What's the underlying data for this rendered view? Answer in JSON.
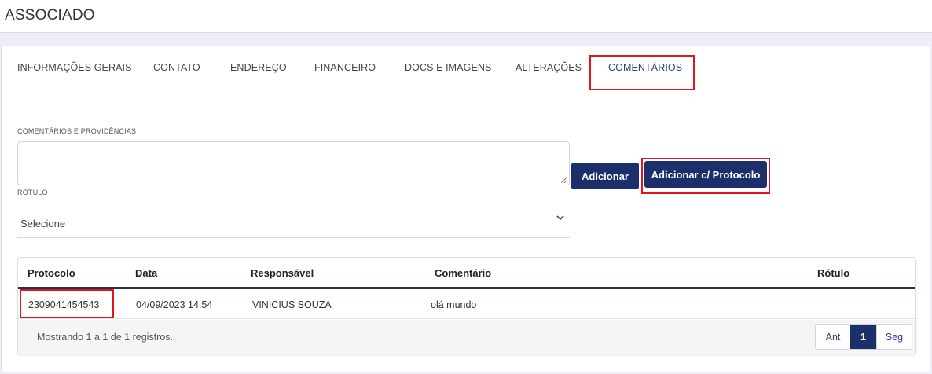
{
  "header": {
    "title": "ASSOCIADO"
  },
  "tabs": [
    {
      "label": "INFORMAÇÕES GERAIS"
    },
    {
      "label": "CONTATO"
    },
    {
      "label": "ENDEREÇO"
    },
    {
      "label": "FINANCEIRO"
    },
    {
      "label": "DOCS E IMAGENS"
    },
    {
      "label": "ALTERAÇÕES"
    },
    {
      "label": "COMENTÁRIOS"
    }
  ],
  "form": {
    "comments_label": "COMENTÁRIOS E PROVIDÊNCIAS",
    "comments_value": "",
    "add_button": "Adicionar",
    "add_protocol_button": "Adicionar c/ Protocolo",
    "label_label": "RÓTULO",
    "label_select_value": "Selecione"
  },
  "table": {
    "columns": [
      "Protocolo",
      "Data",
      "Responsável",
      "Comentário",
      "Rótulo"
    ],
    "rows": [
      {
        "protocolo": "2309041454543",
        "data": "04/09/2023 14:54",
        "responsavel": "VINICIUS SOUZA",
        "comentario": "olá mundo",
        "rotulo": ""
      }
    ],
    "info": "Mostrando 1 a 1 de 1 registros.",
    "pagination": {
      "prev": "Ant",
      "current": "1",
      "next": "Seg"
    }
  },
  "colors": {
    "primary": "#1b2f6b",
    "highlight": "#e0161b"
  },
  "icons": {
    "select_chevron": "chevron-down-icon",
    "textarea_grip": "resize-grip-icon"
  }
}
